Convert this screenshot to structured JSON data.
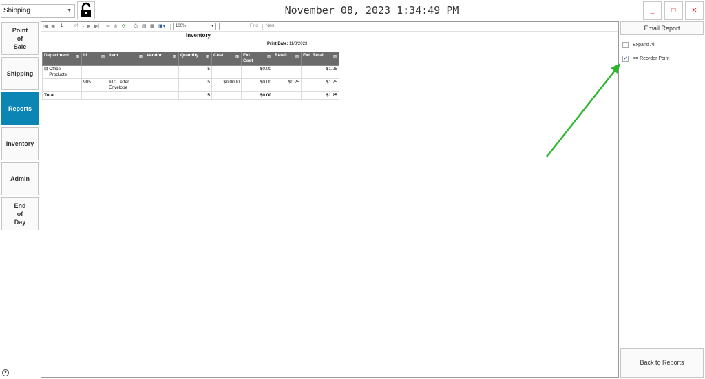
{
  "topbar": {
    "store_select": "Shipping",
    "clock": "November 08, 2023 1:34:49 PM",
    "minimize": "_",
    "maximize": "□",
    "close": "✕"
  },
  "nav": [
    {
      "label": "Point\nof\nSale"
    },
    {
      "label": "Shipping"
    },
    {
      "label": "Reports"
    },
    {
      "label": "Inventory"
    },
    {
      "label": "Admin"
    },
    {
      "label": "End\nof\nDay"
    }
  ],
  "viewer": {
    "page_current": "1",
    "page_of": "of",
    "page_total": "1",
    "zoom": "100%",
    "find_value": "",
    "find_label": "Find",
    "next_label": "Next"
  },
  "report": {
    "title": "Inventory",
    "print_date_label": "Print Date:",
    "print_date": "11/8/2023",
    "columns": [
      "Department",
      "Id",
      "Item",
      "Vendor",
      "Quantity",
      "Cost",
      "Ext.\nCost",
      "Retail",
      "Ext. Retail"
    ],
    "rows": [
      {
        "department": "⊟ Office\n    Products",
        "id": "",
        "item": "",
        "vendor": "",
        "quantity": "5",
        "cost": "",
        "ext_cost": "$0.00",
        "retail": "",
        "ext_retail": "$1.25"
      },
      {
        "department": "",
        "id": "905",
        "item": "#10 Letter\nEnvelope",
        "vendor": "",
        "quantity": "5",
        "cost": "$0.0000",
        "ext_cost": "$0.00",
        "retail": "$0.25",
        "ext_retail": "$1.25"
      }
    ],
    "total": {
      "label": "Total",
      "quantity": "5",
      "ext_cost": "$0.00",
      "ext_retail": "$1.25"
    }
  },
  "right_panel": {
    "email_report": "Email Report",
    "expand_all": "Expand All",
    "expand_all_checked": false,
    "reorder_point": "<= Reorder Point",
    "reorder_point_checked": true,
    "back_to_reports": "Back to Reports"
  },
  "colors": {
    "active_nav": "#0b86b4",
    "header_bg": "#6b6b6b",
    "window_button": "#d9302c",
    "annotation_arrow": "#2db52d"
  }
}
